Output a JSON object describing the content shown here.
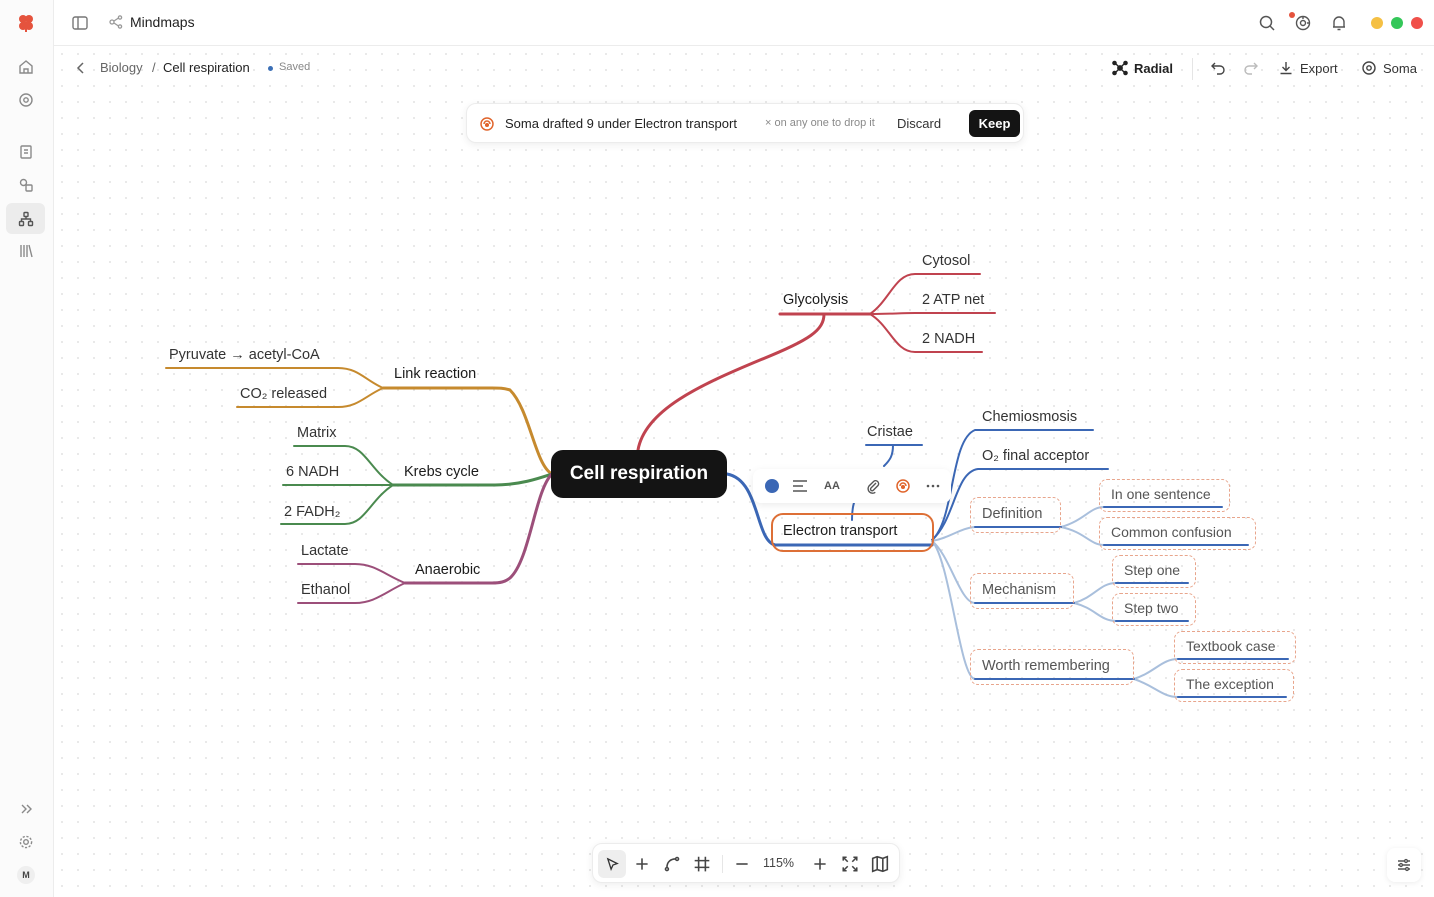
{
  "app": {
    "title": "Mindmaps"
  },
  "breadcrumb": {
    "parent": "Biology",
    "separator": "/",
    "current": "Cell respiration",
    "status": "Saved"
  },
  "toolbar": {
    "layout_label": "Radial",
    "export_label": "Export",
    "assistant_label": "Soma"
  },
  "suggestion": {
    "message": "Soma drafted 9 under Electron transport",
    "hint": "× on any one to drop it",
    "discard_label": "Discard",
    "keep_label": "Keep"
  },
  "mindmap": {
    "root": "Cell respiration",
    "branches": {
      "glycolysis": {
        "label": "Glycolysis",
        "color": "#c0434f",
        "children": [
          "Cytosol",
          "2 ATP net",
          "2 NADH"
        ]
      },
      "link": {
        "label": "Link reaction",
        "color": "#c68a2e",
        "children": [
          "Pyruvate → acetyl-CoA",
          "CO₂ released"
        ]
      },
      "krebs": {
        "label": "Krebs cycle",
        "color": "#4a8a4f",
        "children": [
          "Matrix",
          "6 NADH",
          "2 FADH₂"
        ]
      },
      "anaerobic": {
        "label": "Anaerobic",
        "color": "#9c4f7a",
        "children": [
          "Lactate",
          "Ethanol"
        ]
      },
      "electron": {
        "label": "Electron transport",
        "color": "#3b67b5",
        "children": [
          "Cristae",
          "Chemiosmosis",
          "O₂ final acceptor"
        ],
        "drafted": {
          "definition": {
            "label": "Definition",
            "children": [
              "In one sentence",
              "Common confusion"
            ]
          },
          "mechanism": {
            "label": "Mechanism",
            "children": [
              "Step one",
              "Step two"
            ]
          },
          "remember": {
            "label": "Worth remembering",
            "children": [
              "Textbook case",
              "The exception"
            ]
          }
        }
      }
    }
  },
  "node_toolbar": {
    "text_size_label": "AA"
  },
  "zoom": {
    "level": "115%"
  },
  "colors": {
    "accent": "#dd6f36",
    "brand": "#e5533d",
    "draft_link": "#a9bfdc"
  },
  "window_controls": {
    "minimize": "#f5c044",
    "maximize": "#34c759",
    "close": "#f0504a"
  }
}
